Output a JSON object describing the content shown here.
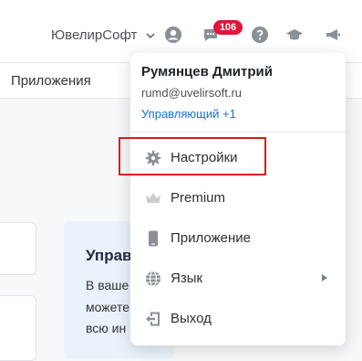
{
  "header": {
    "company": "ЮвелирСофт",
    "notifications_count": "106"
  },
  "subnav": {
    "item": "Приложения"
  },
  "card": {
    "title": "Управ",
    "lines": [
      "В ваше",
      "можете",
      "всю ин"
    ]
  },
  "user_menu": {
    "name": "Румянцев Дмитрий",
    "email": "rumd@uvelirsoft.ru",
    "role": "Управляющий +1",
    "items": [
      {
        "label": "Настройки",
        "icon": "gear-icon"
      },
      {
        "label": "Premium",
        "icon": "crown-icon"
      },
      {
        "label": "Приложение",
        "icon": "phone-icon"
      },
      {
        "label": "Язык",
        "icon": "globe-icon"
      },
      {
        "label": "Выход",
        "icon": "exit-icon"
      }
    ]
  },
  "colors": {
    "accent_link": "#1a6fd6",
    "badge": "#e0143c",
    "highlight": "#e01b1b",
    "icon": "#8a9096"
  }
}
